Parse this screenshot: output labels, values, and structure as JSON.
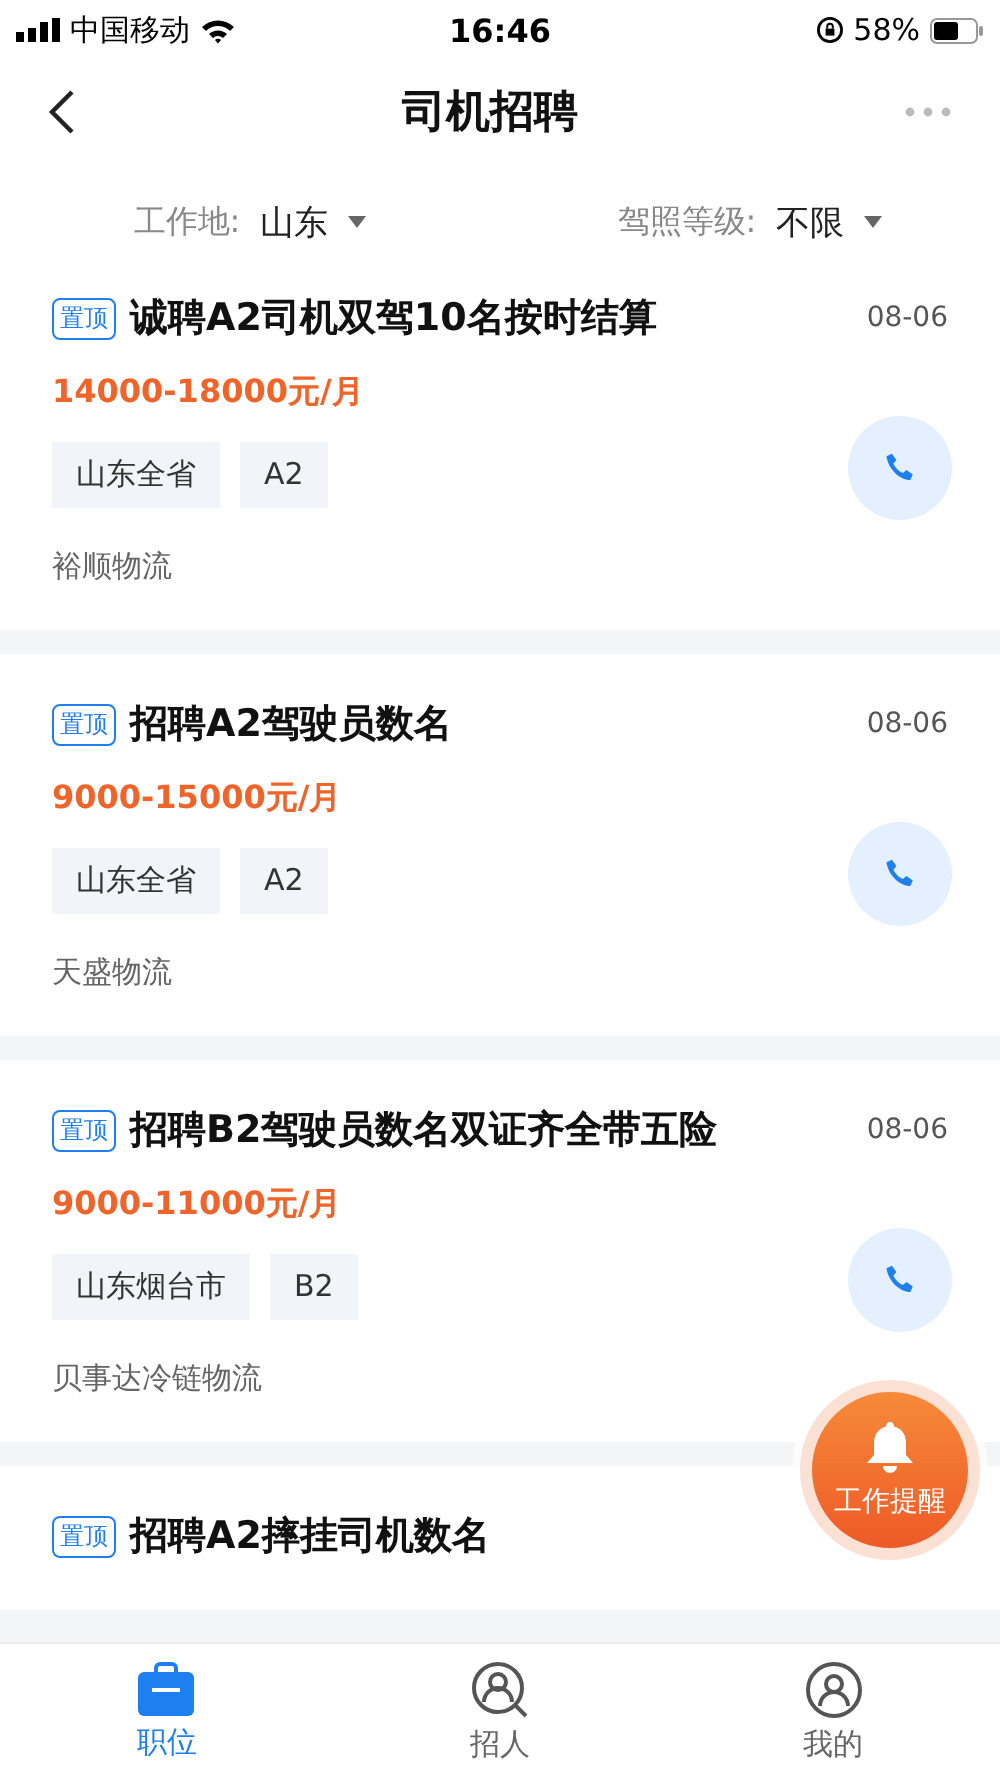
{
  "status_bar": {
    "carrier": "中国移动",
    "time": "16:46",
    "battery": "58%"
  },
  "nav": {
    "title": "司机招聘"
  },
  "filters": [
    {
      "label": "工作地:",
      "value": "山东"
    },
    {
      "label": "驾照等级:",
      "value": "不限"
    }
  ],
  "jobs": [
    {
      "pinned": true,
      "pin_label": "置顶",
      "title": "诚聘A2司机双驾10名按时结算",
      "date": "08-06",
      "salary": "14000-18000元/月",
      "tags": [
        "山东全省",
        "A2"
      ],
      "company": "裕顺物流"
    },
    {
      "pinned": true,
      "pin_label": "置顶",
      "title": "招聘A2驾驶员数名",
      "date": "08-06",
      "salary": "9000-15000元/月",
      "tags": [
        "山东全省",
        "A2"
      ],
      "company": "天盛物流"
    },
    {
      "pinned": true,
      "pin_label": "置顶",
      "title": "招聘B2驾驶员数名双证齐全带五险",
      "date": "08-06",
      "salary": "9000-11000元/月",
      "tags": [
        "山东烟台市",
        "B2"
      ],
      "company": "贝事达冷链物流"
    },
    {
      "pinned": true,
      "pin_label": "置顶",
      "title": "招聘A2摔挂司机数名"
    }
  ],
  "float_button": {
    "label": "工作提醒"
  },
  "tabs": [
    {
      "kind": "job",
      "label": "职位",
      "selected": true
    },
    {
      "kind": "recruit",
      "label": "招人",
      "selected": false
    },
    {
      "kind": "me",
      "label": "我的",
      "selected": false
    }
  ]
}
